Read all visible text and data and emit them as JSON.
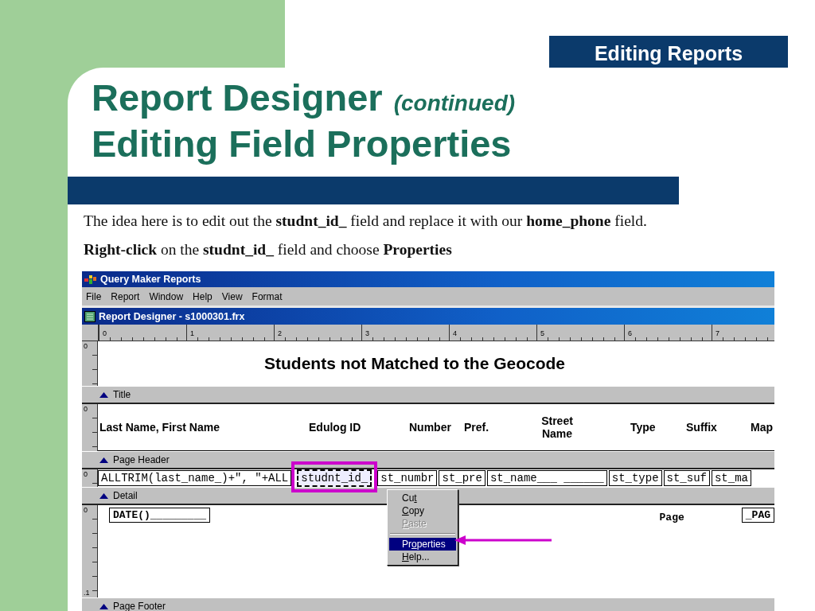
{
  "slide": {
    "section_label": "Editing Reports",
    "title": "Report Designer",
    "title_note": "(continued)",
    "subtitle": "Editing Field Properties",
    "instructions": [
      "The idea here is to edit out the **studnt_id_** field and replace it with our **home_phone** field.",
      "**Right-click** on the **studnt_id_** field and choose **Properties**"
    ]
  },
  "app": {
    "title": "Query Maker Reports",
    "menu": [
      "File",
      "Report",
      "Window",
      "Help",
      "View",
      "Format"
    ]
  },
  "designer": {
    "title": "Report Designer - s1000301.frx",
    "ruler": [
      "0",
      "1",
      "2",
      "3",
      "4",
      "5",
      "6",
      "7"
    ],
    "sections": [
      {
        "kind": "heading",
        "ruler_labels": [
          "0"
        ],
        "heading": "Students not Matched to the Geocode",
        "band": "Title"
      },
      {
        "kind": "labels",
        "ruler_labels": [
          "0"
        ],
        "labels": [
          "Last Name, First Name",
          "Edulog ID",
          "Number",
          "Pref.",
          "Street Name",
          "Type",
          "Suffix",
          "Map"
        ],
        "band": "Page Header"
      },
      {
        "kind": "fields",
        "ruler_labels": [
          "0"
        ],
        "fields": [
          {
            "text": "ALLTRIM(last_name_)+\", \"+ALL",
            "selected": false
          },
          {
            "text": "studnt_id_",
            "selected": true
          },
          {
            "text": "st_numbr",
            "selected": false
          },
          {
            "text": "st_pre",
            "selected": false
          },
          {
            "text": "st_name___ ______",
            "selected": false
          },
          {
            "text": "st_type",
            "selected": false
          },
          {
            "text": "st_suf",
            "selected": false
          },
          {
            "text": "st_ma",
            "selected": false
          }
        ],
        "band": "Detail"
      },
      {
        "kind": "page_items",
        "ruler_labels": [
          "0",
          ".1"
        ],
        "items": [
          {
            "kind": "field",
            "text": "DATE()_________"
          },
          {
            "kind": "label",
            "text": "Page"
          },
          {
            "kind": "field",
            "text": "_PAG"
          }
        ],
        "band": "Page Footer"
      }
    ]
  },
  "context_menu": [
    {
      "kind": "item",
      "label": {
        "before": "Cu",
        "key": "t"
      },
      "disabled": false,
      "selected": false
    },
    {
      "kind": "item",
      "label": {
        "key": "C",
        "after": "opy"
      },
      "disabled": false,
      "selected": false
    },
    {
      "kind": "item",
      "label": {
        "key": "P",
        "after": "aste"
      },
      "disabled": true,
      "selected": false
    },
    {
      "kind": "separator"
    },
    {
      "kind": "item",
      "label": {
        "before": "Pr",
        "key": "o",
        "after": "perties"
      },
      "disabled": false,
      "selected": true
    },
    {
      "kind": "item",
      "label": {
        "key": "H",
        "after": "elp..."
      },
      "disabled": false,
      "selected": false
    }
  ]
}
